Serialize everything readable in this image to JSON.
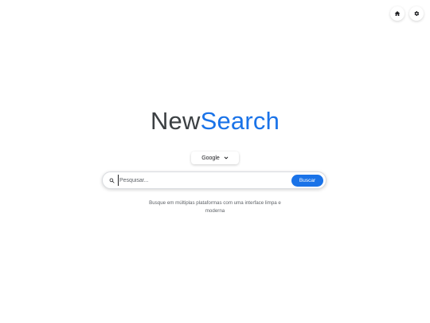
{
  "header": {
    "icons": [
      {
        "name": "home-icon"
      },
      {
        "name": "gear-icon"
      }
    ]
  },
  "logo": {
    "part1": "New",
    "part2": "Search",
    "colors": {
      "part1": "#3c4043",
      "part2": "#1a73e8"
    }
  },
  "engine_select": {
    "selected": "Google",
    "icon": "chevron-down-icon"
  },
  "search": {
    "placeholder": "Pesquisar...",
    "value": "",
    "icon": "search-icon",
    "button_label": "Buscar",
    "button_color": "#1a73e8"
  },
  "description": {
    "text": "Busque em múltiplas plataformas com uma interface limpa e moderna"
  }
}
